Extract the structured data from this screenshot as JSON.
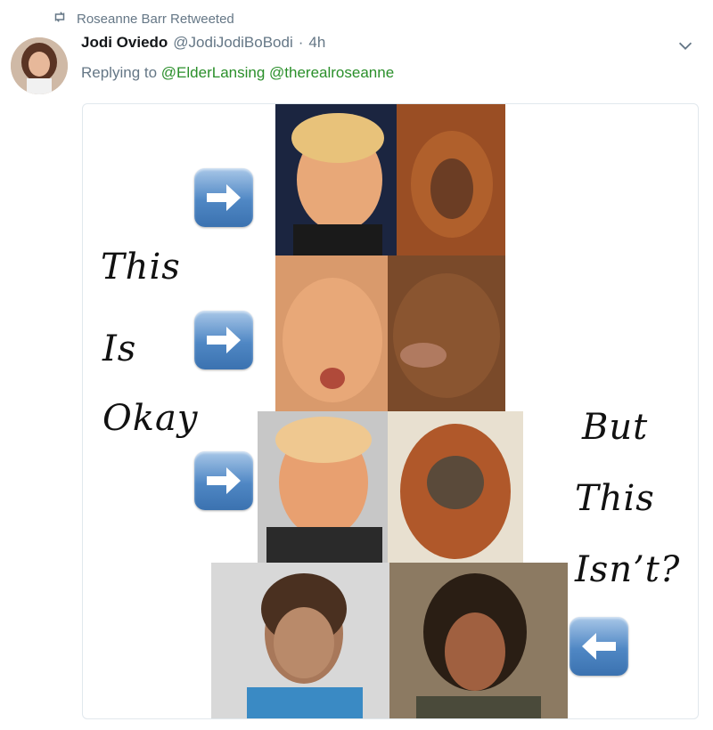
{
  "retweet": {
    "text": "Roseanne Barr Retweeted"
  },
  "tweet": {
    "display_name": "Jodi Oviedo",
    "handle": "@JodiJodiBoBodi",
    "separator": "·",
    "time": "4h",
    "replying_prefix": "Replying to",
    "mentions": [
      "@ElderLansing",
      "@therealroseanne"
    ]
  },
  "image_text": {
    "left": [
      "This",
      "Is",
      "Okay"
    ],
    "right": [
      "But",
      "This",
      "Isn’t?"
    ]
  },
  "colors": {
    "mention": "#2a8f2a",
    "muted": "#657786",
    "arrow_blue": "#4f87c4"
  }
}
